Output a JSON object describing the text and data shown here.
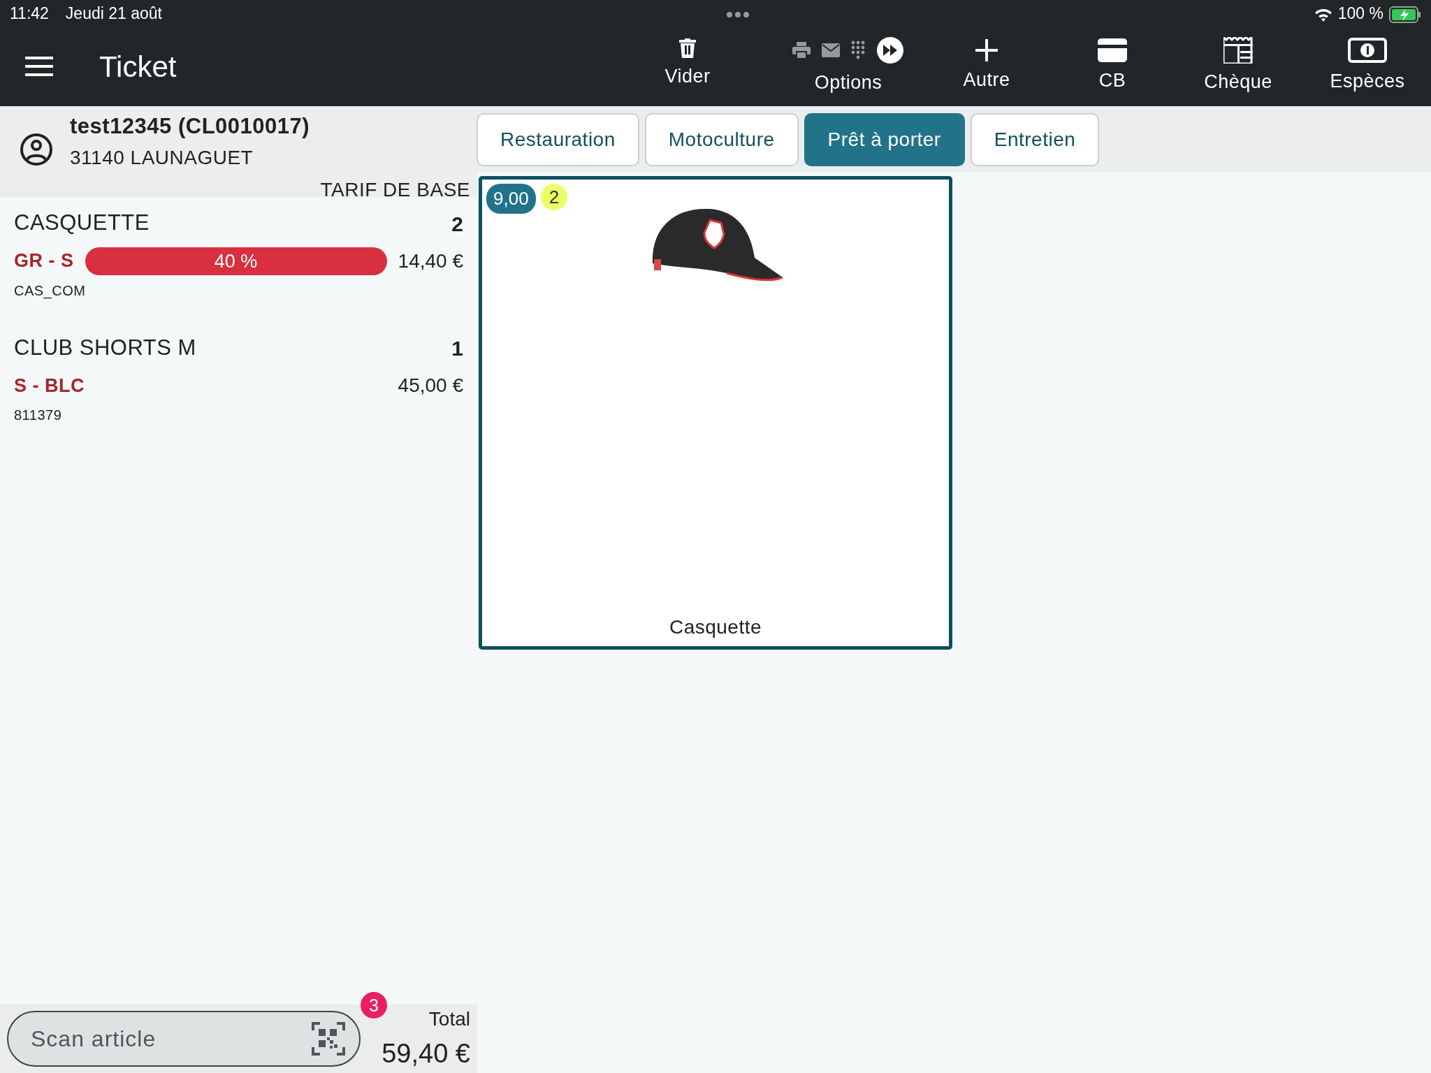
{
  "status_bar": {
    "time": "11:42",
    "date": "Jeudi 21 août",
    "battery": "100 %"
  },
  "toolbar": {
    "title": "Ticket",
    "buttons": [
      {
        "kind": "trash",
        "label": "Vider"
      },
      {
        "kind": "options",
        "label": "Options"
      },
      {
        "kind": "plus",
        "label": "Autre"
      },
      {
        "kind": "card",
        "label": "CB"
      },
      {
        "kind": "cheque",
        "label": "Chèque"
      },
      {
        "kind": "cash",
        "label": "Espèces"
      }
    ]
  },
  "customer": {
    "name": "test12345 (CL0010017)",
    "city": "31140 LAUNAGUET",
    "tariff": "TARIF DE BASE"
  },
  "cart": [
    {
      "name": "CASQUETTE",
      "quantity": "2",
      "variant": "GR - S",
      "discount": "40 %",
      "price": "14,40 €",
      "code": "CAS_COM"
    },
    {
      "name": "CLUB SHORTS M",
      "quantity": "1",
      "variant": "S - BLC",
      "price": "45,00 €",
      "code": "811379"
    }
  ],
  "categories": [
    {
      "label": "Restauration",
      "selected": false
    },
    {
      "label": "Motoculture",
      "selected": false
    },
    {
      "label": "Prêt à porter",
      "selected": true
    },
    {
      "label": "Entretien",
      "selected": false
    }
  ],
  "products": [
    {
      "name": "Casquette",
      "price": "9,00",
      "count": "2"
    }
  ],
  "scan": {
    "placeholder": "Scan article",
    "badge": "3"
  },
  "total": {
    "label": "Total",
    "amount": "59,40 €"
  }
}
